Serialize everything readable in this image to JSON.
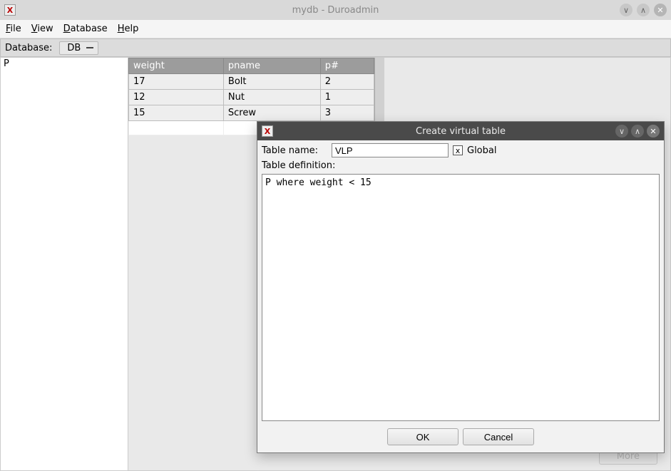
{
  "window": {
    "title": "mydb - Duroadmin",
    "app_icon_letter": "X"
  },
  "menubar": {
    "file": "File",
    "view": "View",
    "database": "Database",
    "help": "Help"
  },
  "toolbar": {
    "db_label": "Database:",
    "db_value": "DB"
  },
  "sidebar": {
    "items": [
      "P"
    ]
  },
  "table": {
    "columns": [
      "weight",
      "pname",
      "p#"
    ],
    "rows": [
      {
        "weight": "17",
        "pname": "Bolt",
        "pnum": "2"
      },
      {
        "weight": "12",
        "pname": "Nut",
        "pnum": "1"
      },
      {
        "weight": "15",
        "pname": "Screw",
        "pnum": "3"
      }
    ]
  },
  "more_label": "More",
  "dialog": {
    "title": "Create virtual table",
    "app_icon_letter": "X",
    "table_name_label": "Table name:",
    "table_name_value": "VLP",
    "global_label": "Global",
    "global_checked": "x",
    "definition_label": "Table definition:",
    "definition_value": "P where weight < 15",
    "ok_label": "OK",
    "cancel_label": "Cancel"
  }
}
